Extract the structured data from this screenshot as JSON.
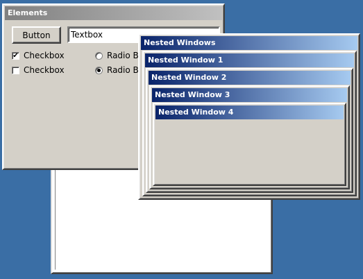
{
  "elements_window": {
    "title": "Elements",
    "button_label": "Button",
    "textbox_value": "Textbox",
    "checkboxes": [
      {
        "label": "Checkbox",
        "checked": true,
        "mark": "✔"
      },
      {
        "label": "Checkbox",
        "checked": false,
        "mark": ""
      }
    ],
    "radios": [
      {
        "label": "Radio Button",
        "selected": false
      },
      {
        "label": "Radio Button",
        "selected": true
      }
    ]
  },
  "nested_windows": [
    {
      "title": "Nested Windows"
    },
    {
      "title": "Nested Window 1"
    },
    {
      "title": "Nested Window 2"
    },
    {
      "title": "Nested Window 3"
    },
    {
      "title": "Nested Window 4"
    }
  ],
  "colors": {
    "desktop": "#3a6ea5",
    "window_face": "#d4d0c8",
    "active_title_start": "#0a246a",
    "active_title_end": "#a6caf0",
    "inactive_title_start": "#808080",
    "inactive_title_end": "#c0c0c0"
  }
}
